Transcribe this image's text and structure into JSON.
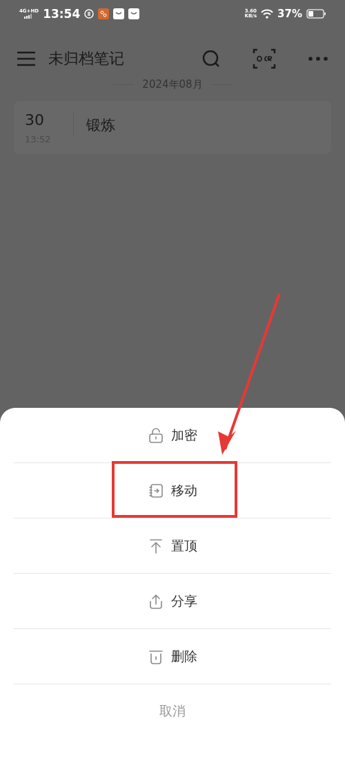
{
  "status_bar": {
    "network": "4G+HD",
    "time": "13:54",
    "speed_value": "3.60",
    "speed_unit": "KB/s",
    "battery": "37%"
  },
  "header": {
    "title": "未归档笔记"
  },
  "month_label": "2024年08月",
  "notes": [
    {
      "day": "30",
      "time": "13:52",
      "title": "锻炼"
    }
  ],
  "action_sheet": {
    "items": [
      {
        "kind": "lock",
        "label": "加密",
        "highlighted": false
      },
      {
        "kind": "move",
        "label": "移动",
        "highlighted": true
      },
      {
        "kind": "pin",
        "label": "置顶",
        "highlighted": false
      },
      {
        "kind": "share",
        "label": "分享",
        "highlighted": false
      },
      {
        "kind": "delete",
        "label": "删除",
        "highlighted": false
      }
    ],
    "cancel": "取消"
  }
}
